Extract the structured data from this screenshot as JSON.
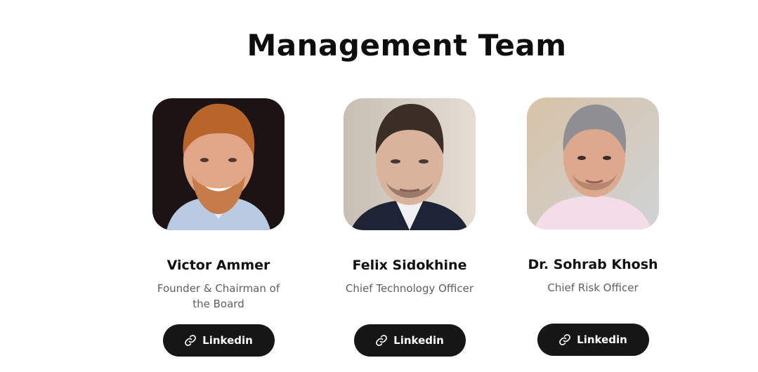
{
  "section": {
    "title": "Management Team"
  },
  "team": [
    {
      "name": "Victor Ammer",
      "role": "Founder & Chairman of the Board",
      "button": "Linkedin"
    },
    {
      "name": "Felix Sidokhine",
      "role": "Chief Technology Officer",
      "button": "Linkedin"
    },
    {
      "name": "Dr. Sohrab Khosh",
      "role": "Chief Risk Officer",
      "button": "Linkedin"
    }
  ],
  "icons": {
    "button_icon": "link-icon"
  },
  "colors": {
    "button_bg": "#161616",
    "button_text": "#ffffff",
    "title": "#0d0d0d",
    "role_text": "#5f5f5f"
  }
}
